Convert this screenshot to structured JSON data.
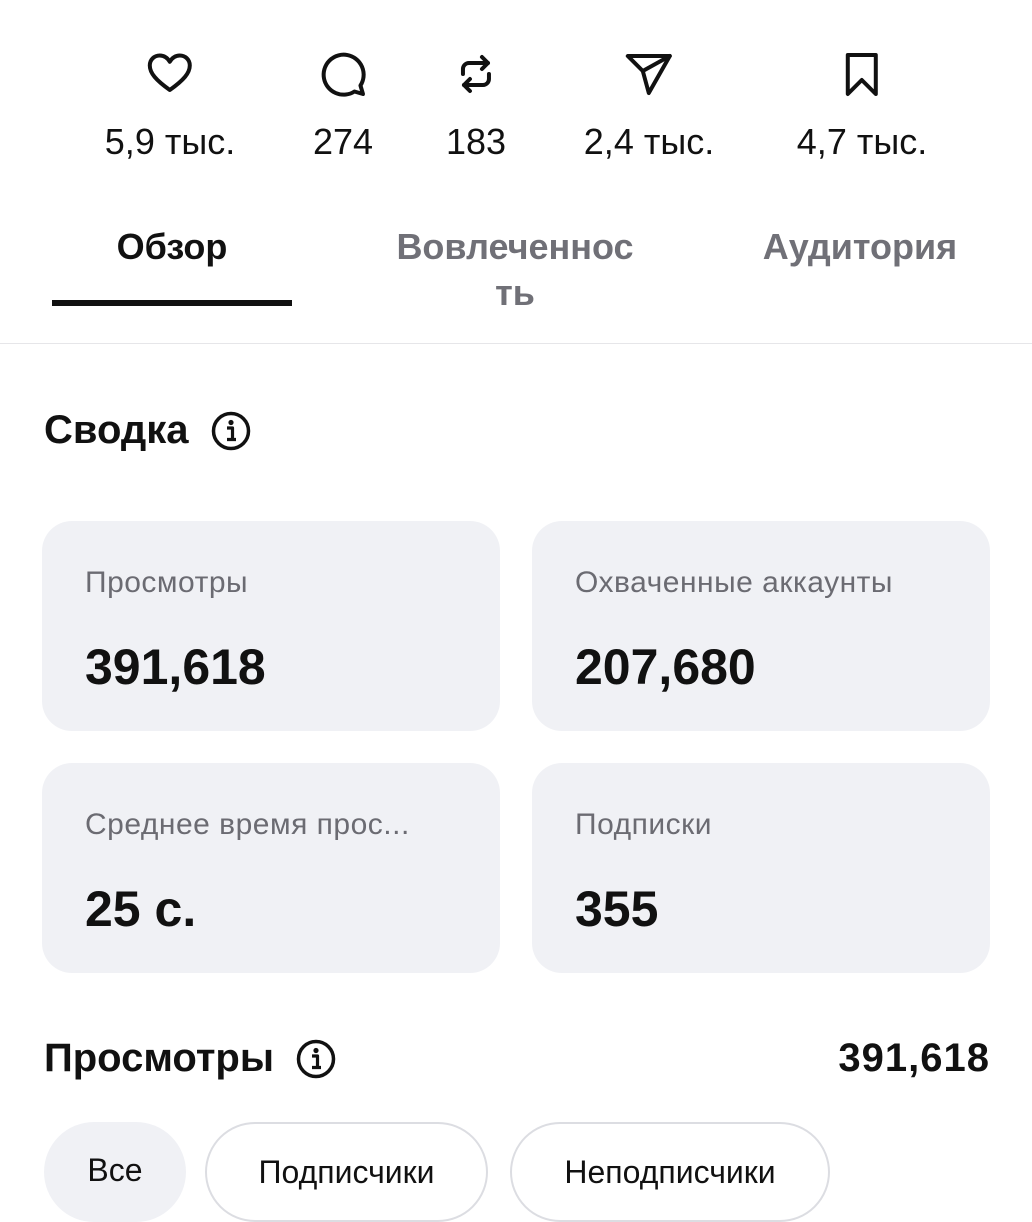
{
  "stats": [
    {
      "icon": "heart-icon",
      "count": "5,9 тыс."
    },
    {
      "icon": "comment-icon",
      "count": "274"
    },
    {
      "icon": "repost-icon",
      "count": "183"
    },
    {
      "icon": "share-icon",
      "count": "2,4 тыс."
    },
    {
      "icon": "bookmark-icon",
      "count": "4,7 тыс."
    }
  ],
  "tabs": {
    "overview": "Обзор",
    "engagement": "Вовлеченность",
    "audience": "Аудитория",
    "active": "overview"
  },
  "summary": {
    "title": "Сводка",
    "cards": {
      "views": {
        "label": "Просмотры",
        "value": "391,618"
      },
      "reach": {
        "label": "Охваченные аккаунты",
        "value": "207,680"
      },
      "watch_time": {
        "label": "Среднее время прос...",
        "value": "25 с."
      },
      "follows": {
        "label": "Подписки",
        "value": "355"
      }
    }
  },
  "views_section": {
    "title": "Просмотры",
    "total": "391,618",
    "filters": [
      {
        "label": "Все",
        "selected": true
      },
      {
        "label": "Подписчики",
        "selected": false
      },
      {
        "label": "Неподписчики",
        "selected": false
      }
    ]
  },
  "colors": {
    "text_primary": "#111111",
    "text_secondary": "#6b6b72",
    "card_background": "#f0f1f5",
    "chip_border": "#dcdde2"
  }
}
